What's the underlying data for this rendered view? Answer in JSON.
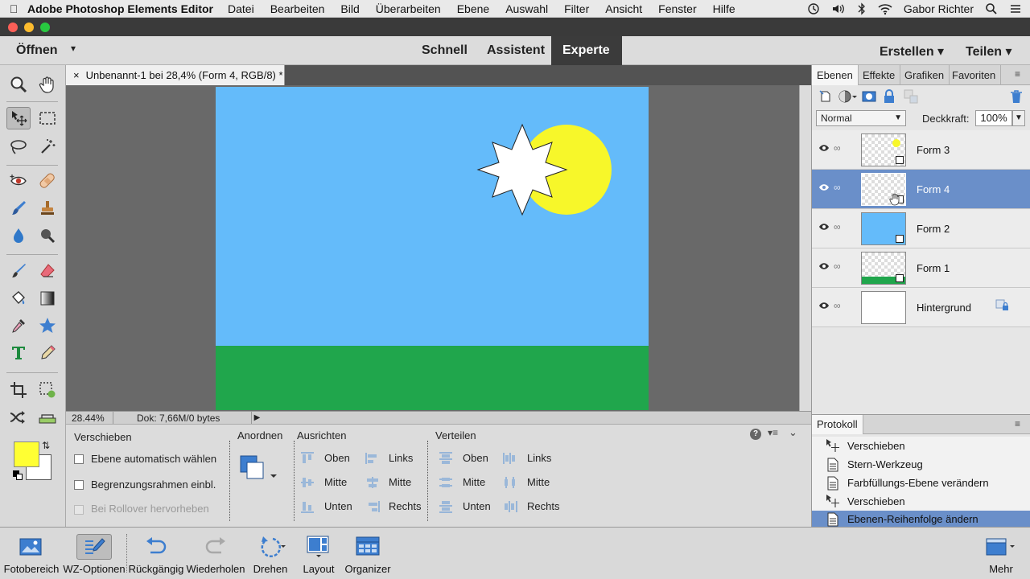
{
  "menubar": {
    "app_name": "Adobe Photoshop Elements Editor",
    "menus": [
      "Datei",
      "Bearbeiten",
      "Bild",
      "Überarbeiten",
      "Ebene",
      "Auswahl",
      "Filter",
      "Ansicht",
      "Fenster",
      "Hilfe"
    ],
    "user": "Gabor Richter"
  },
  "modebar": {
    "open_label": "Öffnen",
    "tabs": [
      {
        "label": "Schnell"
      },
      {
        "label": "Assistent"
      },
      {
        "label": "Experte",
        "active": true
      }
    ],
    "create_label": "Erstellen",
    "share_label": "Teilen"
  },
  "document": {
    "tab_title": "Unbenannt-1 bei 28,4% (Form 4, RGB/8) *",
    "zoom": "28.44%",
    "doc_info": "Dok: 7,66M/0 bytes"
  },
  "options": {
    "tool_name": "Verschieben",
    "checkboxes": [
      {
        "label": "Ebene automatisch wählen",
        "enabled": true
      },
      {
        "label": "Begrenzungsrahmen einbl.",
        "enabled": true
      },
      {
        "label": "Bei Rollover hervorheben",
        "enabled": false
      }
    ],
    "arrange_title": "Anordnen",
    "align_title": "Ausrichten",
    "align_col1": [
      "Oben",
      "Mitte",
      "Unten"
    ],
    "align_col2": [
      "Links",
      "Mitte",
      "Rechts"
    ],
    "distribute_title": "Verteilen",
    "distribute_col1": [
      "Oben",
      "Mitte",
      "Unten"
    ],
    "distribute_col2": [
      "Links",
      "Mitte",
      "Rechts"
    ]
  },
  "layers_panel": {
    "tabs": [
      "Ebenen",
      "Effekte",
      "Grafiken",
      "Favoriten"
    ],
    "blend_mode": "Normal",
    "opacity_label": "Deckkraft:",
    "opacity_value": "100%",
    "layers": [
      {
        "name": "Form 3",
        "selected": false
      },
      {
        "name": "Form 4",
        "selected": true
      },
      {
        "name": "Form 2",
        "selected": false
      },
      {
        "name": "Form 1",
        "selected": false
      },
      {
        "name": "Hintergrund",
        "selected": false
      }
    ]
  },
  "history_panel": {
    "title": "Protokoll",
    "items": [
      {
        "label": "Verschieben",
        "icon": "move-icon"
      },
      {
        "label": "Stern-Werkzeug",
        "icon": "document-icon"
      },
      {
        "label": "Farbfüllungs-Ebene verändern",
        "icon": "document-icon"
      },
      {
        "label": "Verschieben",
        "icon": "move-icon"
      },
      {
        "label": "Ebenen-Reihenfolge ändern",
        "icon": "document-icon",
        "selected": true
      }
    ]
  },
  "taskbar": {
    "items": [
      "Fotobereich",
      "WZ-Optionen",
      "Rückgängig",
      "Wiederholen",
      "Drehen",
      "Layout",
      "Organizer"
    ],
    "more_label": "Mehr"
  },
  "colors": {
    "foreground": "#ffff33",
    "background": "#ffffff",
    "sky": "#64bbfa",
    "ground": "#20a64c",
    "sun": "#f7f72a",
    "selection": "#6a8fc9"
  }
}
